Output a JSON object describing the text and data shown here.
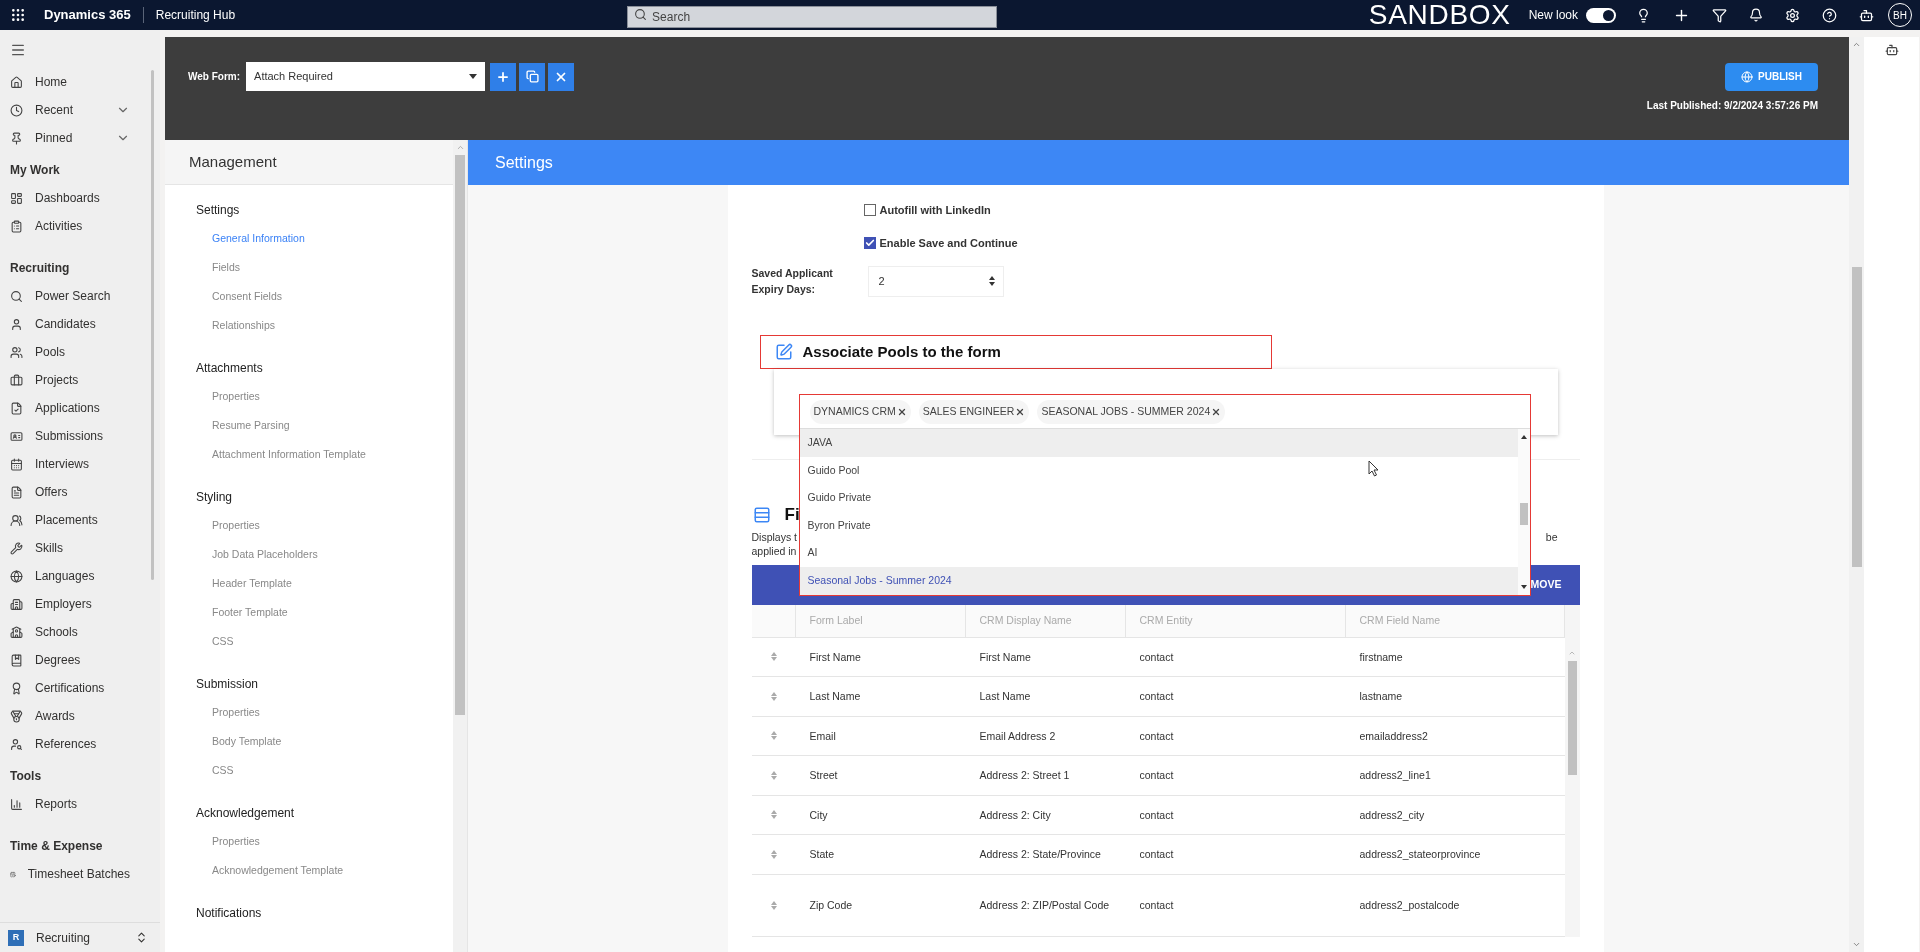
{
  "top_bar": {
    "app_name": "Dynamics 365",
    "area": "Recruiting Hub",
    "search": {
      "placeholder": "Search"
    },
    "environment": "SANDBOX",
    "new_look": {
      "label": "New look",
      "on": true
    },
    "avatar": "BH"
  },
  "nav": {
    "sections": [
      {
        "items": [
          {
            "label": "Home",
            "kind": "link"
          },
          {
            "label": "Recent",
            "kind": "flyout"
          },
          {
            "label": "Pinned",
            "kind": "flyout"
          }
        ]
      },
      {
        "title": "My Work",
        "items": [
          {
            "label": "Dashboards",
            "kind": "link"
          },
          {
            "label": "Activities",
            "kind": "link"
          }
        ]
      },
      {
        "title": "Recruiting",
        "items": [
          {
            "label": "Power Search",
            "kind": "link"
          },
          {
            "label": "Candidates",
            "kind": "link"
          },
          {
            "label": "Pools",
            "kind": "link"
          },
          {
            "label": "Projects",
            "kind": "link"
          },
          {
            "label": "Applications",
            "kind": "link"
          },
          {
            "label": "Submissions",
            "kind": "link"
          },
          {
            "label": "Interviews",
            "kind": "link"
          },
          {
            "label": "Offers",
            "kind": "link"
          },
          {
            "label": "Placements",
            "kind": "link"
          },
          {
            "label": "Skills",
            "kind": "link"
          },
          {
            "label": "Languages",
            "kind": "link"
          },
          {
            "label": "Employers",
            "kind": "link"
          },
          {
            "label": "Schools",
            "kind": "link"
          },
          {
            "label": "Degrees",
            "kind": "link"
          },
          {
            "label": "Certifications",
            "kind": "link"
          },
          {
            "label": "Awards",
            "kind": "link"
          },
          {
            "label": "References",
            "kind": "link"
          }
        ]
      },
      {
        "title": "Tools",
        "items": [
          {
            "label": "Reports",
            "kind": "link"
          }
        ]
      },
      {
        "title": "Time & Expense",
        "items": [
          {
            "label": "Timesheet Batches",
            "kind": "link"
          }
        ]
      }
    ],
    "area_switcher": {
      "badge": "R",
      "label": "Recruiting"
    }
  },
  "header": {
    "web_form_label": "Web Form:",
    "web_form_value": "Attach Required",
    "publish": "PUBLISH",
    "last_published": "Last Published: 9/2/2024 3:57:26 PM"
  },
  "management": {
    "title": "Management",
    "sections": [
      {
        "title": "Settings",
        "items": [
          {
            "label": "General Information",
            "selected": true
          },
          {
            "label": "Fields",
            "selected": false
          },
          {
            "label": "Consent Fields",
            "selected": false
          },
          {
            "label": "Relationships",
            "selected": false
          }
        ]
      },
      {
        "title": "Attachments",
        "items": [
          {
            "label": "Properties",
            "selected": false
          },
          {
            "label": "Resume Parsing",
            "selected": false
          },
          {
            "label": "Attachment Information Template",
            "selected": false
          }
        ]
      },
      {
        "title": "Styling",
        "items": [
          {
            "label": "Properties",
            "selected": false
          },
          {
            "label": "Job Data Placeholders",
            "selected": false
          },
          {
            "label": "Header Template",
            "selected": false
          },
          {
            "label": "Footer Template",
            "selected": false
          },
          {
            "label": "CSS",
            "selected": false
          }
        ]
      },
      {
        "title": "Submission",
        "items": [
          {
            "label": "Properties",
            "selected": false
          },
          {
            "label": "Body Template",
            "selected": false
          },
          {
            "label": "CSS",
            "selected": false
          }
        ]
      },
      {
        "title": "Acknowledgement",
        "items": [
          {
            "label": "Properties",
            "selected": false
          },
          {
            "label": "Acknowledgement Template",
            "selected": false
          }
        ]
      },
      {
        "title": "Notifications"
      }
    ]
  },
  "settings": {
    "title": "Settings",
    "checkboxes": [
      {
        "label": "Autofill with LinkedIn",
        "checked": false
      },
      {
        "label": "Enable Save and Continue",
        "checked": true
      }
    ],
    "expiry": {
      "label_lines": [
        "Saved Applicant",
        "Expiry Days:"
      ],
      "value": "2"
    },
    "pools": {
      "title": "Associate Pools to the form",
      "chips": [
        "DYNAMICS CRM",
        "SALES ENGINEER",
        "SEASONAL JOBS - SUMMER 2024"
      ],
      "options": [
        {
          "label": "JAVA",
          "highlighted": true,
          "selected": false
        },
        {
          "label": "Guido Pool",
          "highlighted": false,
          "selected": false
        },
        {
          "label": "Guido Private",
          "highlighted": false,
          "selected": false
        },
        {
          "label": "Byron Private",
          "highlighted": false,
          "selected": false
        },
        {
          "label": "AI",
          "highlighted": false,
          "selected": false
        },
        {
          "label": "Seasonal Jobs - Summer 2024",
          "highlighted": true,
          "selected": true
        }
      ]
    },
    "fields": {
      "title": "Fi",
      "description_lines": [
        "Displays t",
        "applied in"
      ],
      "description_tail": "be",
      "toolbar_visible_text": "MOVE",
      "columns": [
        "Form Label",
        "CRM Display Name",
        "CRM Entity",
        "CRM Field Name"
      ],
      "rows": [
        [
          "First Name",
          "First Name",
          "contact",
          "firstname"
        ],
        [
          "Last Name",
          "Last Name",
          "contact",
          "lastname"
        ],
        [
          "Email",
          "Email Address 2",
          "contact",
          "emailaddress2"
        ],
        [
          "Street",
          "Address 2: Street 1",
          "contact",
          "address2_line1"
        ],
        [
          "City",
          "Address 2: City",
          "contact",
          "address2_city"
        ],
        [
          "State",
          "Address 2: State/Province",
          "contact",
          "address2_stateorprovince"
        ],
        [
          "Zip Code",
          "Address 2: ZIP/Postal Code",
          "contact",
          "address2_postalcode"
        ]
      ]
    }
  }
}
